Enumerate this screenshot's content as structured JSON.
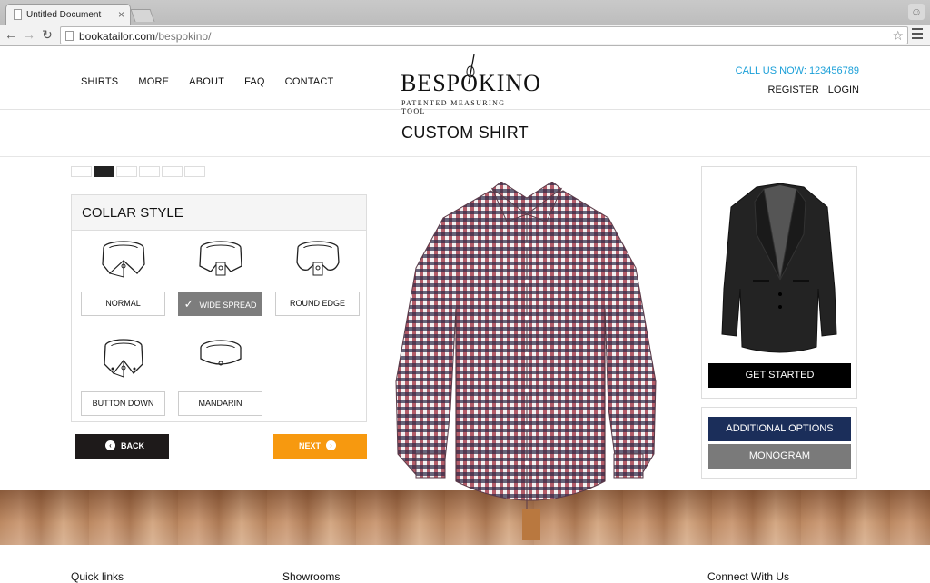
{
  "browser": {
    "tab_title": "Untitled Document",
    "tab_close": "×",
    "url_host": "bookatailor.com",
    "url_path": "/bespokino/"
  },
  "header": {
    "nav": [
      "SHIRTS",
      "MORE",
      "ABOUT",
      "FAQ",
      "CONTACT"
    ],
    "logo_word": "BESPOKINO",
    "logo_sub": "PATENTED MEASURING TOOL",
    "call": "CALL US NOW: 123456789",
    "register": "REGISTER",
    "login": "LOGIN"
  },
  "page": {
    "title": "CUSTOM SHIRT"
  },
  "steps": {
    "count": 6,
    "active_index": 1
  },
  "collar": {
    "heading": "COLLAR STYLE",
    "options": [
      {
        "label": "NORMAL",
        "selected": false
      },
      {
        "label": "WIDE SPREAD",
        "selected": true
      },
      {
        "label": "ROUND EDGE",
        "selected": false
      },
      {
        "label": "BUTTON DOWN",
        "selected": false
      },
      {
        "label": "MANDARIN",
        "selected": false
      }
    ]
  },
  "buttons": {
    "back": "BACK",
    "next": "NEXT",
    "get_started": "GET STARTED",
    "additional_options": "ADDITIONAL OPTIONS",
    "monogram": "MONOGRAM"
  },
  "footer": {
    "quick_links": "Quick links",
    "showrooms": "Showrooms",
    "connect": "Connect With Us"
  },
  "colors": {
    "call_link": "#1a9fd8",
    "next_button": "#f7990f",
    "back_button": "#1e1a1a",
    "additional_options": "#1b2e5a",
    "monogram": "#7a7a7a",
    "selected_option": "#7d7d7d"
  }
}
